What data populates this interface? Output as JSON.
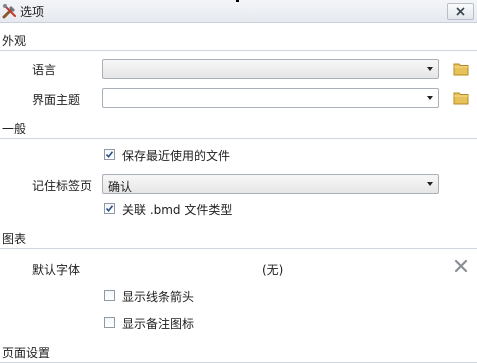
{
  "window": {
    "title": "选项"
  },
  "sections": {
    "appearance": "外观",
    "general": "一般",
    "chart": "图表",
    "page_setup": "页面设置"
  },
  "appearance": {
    "language_label": "语言",
    "language_value": "",
    "theme_label": "界面主题",
    "theme_value": ""
  },
  "general": {
    "save_recent_label": "保存最近使用的文件",
    "save_recent_checked": true,
    "remember_tabs_label": "记住标签页",
    "remember_tabs_value": "确认",
    "associate_bmd_label": "关联 .bmd 文件类型",
    "associate_bmd_checked": true
  },
  "chart": {
    "default_font_label": "默认字体",
    "default_font_value": "(无)",
    "show_arrows_label": "显示线条箭头",
    "show_arrows_checked": false,
    "show_note_icons_label": "显示备注图标",
    "show_note_icons_checked": false
  },
  "icons": {
    "app": "tools-icon",
    "close": "close-icon",
    "folder": "folder-icon",
    "dropdown": "chevron-down-icon",
    "clear": "clear-icon"
  }
}
